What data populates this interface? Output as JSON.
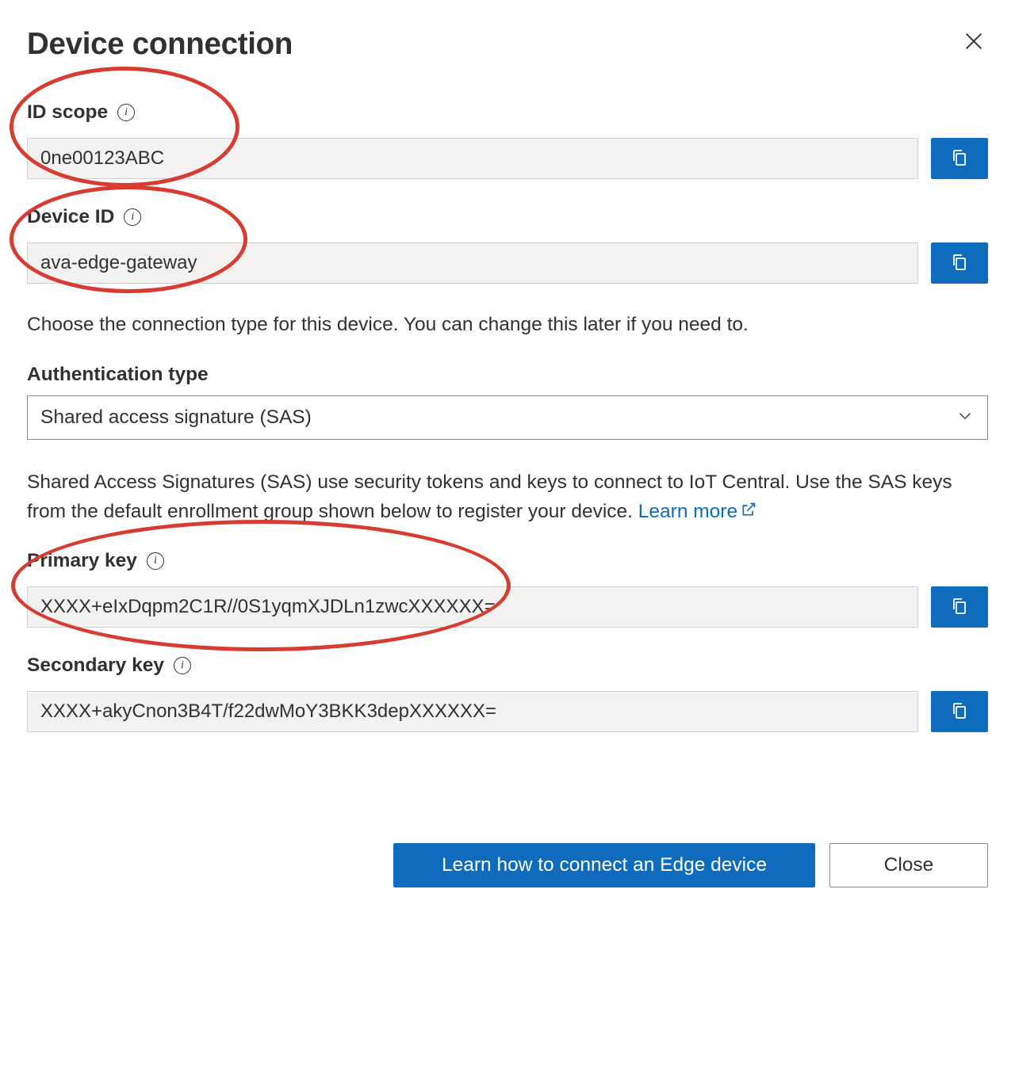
{
  "title": "Device connection",
  "fields": {
    "id_scope": {
      "label": "ID scope",
      "value": "0ne00123ABC"
    },
    "device_id": {
      "label": "Device ID",
      "value": "ava-edge-gateway"
    },
    "primary_key": {
      "label": "Primary key",
      "value": "XXXX+eIxDqpm2C1R//0S1yqmXJDLn1zwcXXXXXX="
    },
    "secondary_key": {
      "label": "Secondary key",
      "value": "XXXX+akyCnon3B4T/f22dwMoY3BKK3depXXXXXX="
    }
  },
  "conn_type_description": "Choose the connection type for this device. You can change this later if you need to.",
  "auth_type": {
    "label": "Authentication type",
    "selected": "Shared access signature (SAS)"
  },
  "sas_description": "Shared Access Signatures (SAS) use security tokens and keys to connect to IoT Central. Use the SAS keys from the default enrollment group shown below to register your device. ",
  "learn_more_label": "Learn more",
  "footer": {
    "primary_label": "Learn how to connect an Edge device",
    "secondary_label": "Close"
  }
}
